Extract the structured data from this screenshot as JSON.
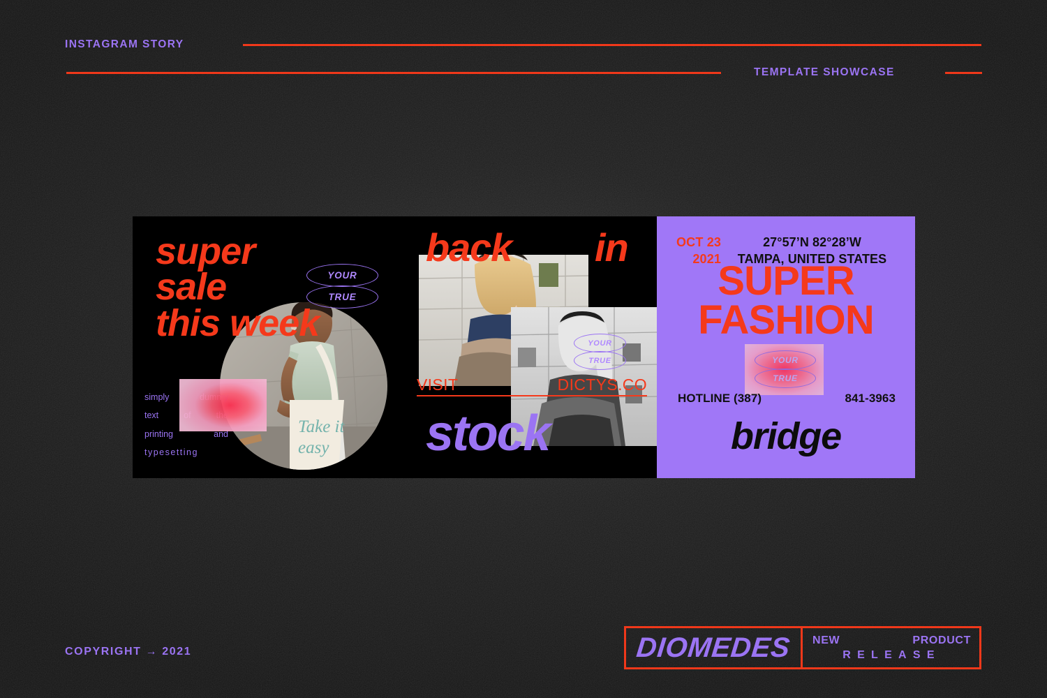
{
  "theme": {
    "bg": "#141414",
    "accent_red": "#f5391b",
    "accent_purple": "#9b74f3",
    "panel_purple": "#a077f7",
    "black": "#000000"
  },
  "header": {
    "left_label": "INSTAGRAM STORY",
    "right_label": "TEMPLATE SHOWCASE"
  },
  "footer": {
    "copyright": "COPYRIGHT  →   2021",
    "brand": {
      "logo": "DIOMEDES",
      "new": "NEW",
      "product": "PRODUCT",
      "release": "RELEASE"
    }
  },
  "artboard": {
    "panel_left": {
      "headline": "super\nsale\nthis week",
      "badges": [
        "YOUR",
        "TRUE"
      ],
      "dummy_text": {
        "line1_a": "simply",
        "line1_b": "dummy",
        "line2_a": "text",
        "line2_b": "of",
        "line2_c": "the",
        "line3_a": "printing",
        "line3_b": "and",
        "line4": "typesetting"
      },
      "photo_caption": "Take it easy"
    },
    "panel_mid": {
      "word_back": "back",
      "word_in": "in",
      "word_stock": "stock",
      "badges": [
        "YOUR",
        "TRUE"
      ],
      "visit_label": "VISIT",
      "visit_url": "DICTYS.CO"
    },
    "panel_right": {
      "date_line1": "OCT 23",
      "date_line2": "2021",
      "coordinates": "27°57’N  82°28’W",
      "location": "TAMPA, UNITED STATES",
      "headline": "SUPER\nFASHION",
      "badges": [
        "YOUR",
        "TRUE"
      ],
      "hotline_label": "HOTLINE (387)",
      "hotline_number": "841-3963",
      "wordmark": "bridge"
    }
  }
}
